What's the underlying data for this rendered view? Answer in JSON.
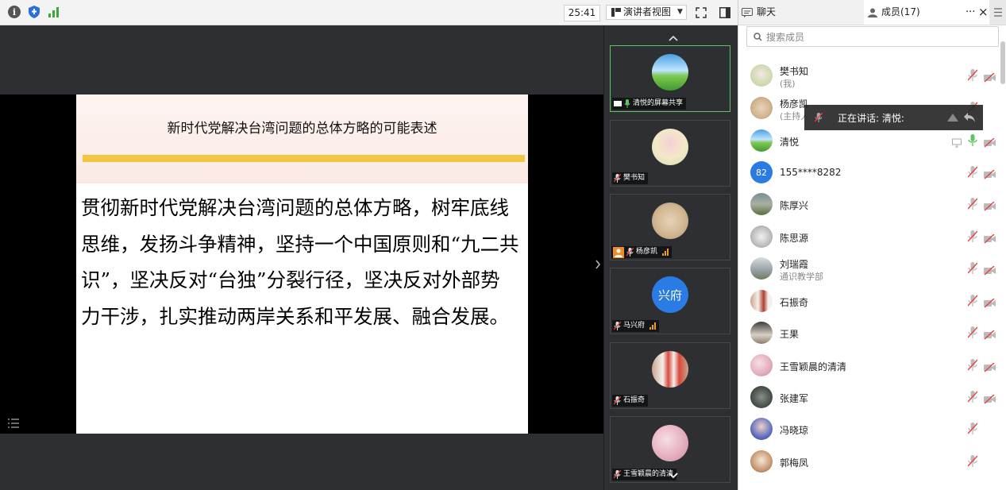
{
  "toolbar": {
    "info_icon_label": "i",
    "timer": "25:41",
    "view_label": "演讲者视图"
  },
  "slide": {
    "title": "新时代党解决台湾问题的总体方略的可能表述",
    "body": "贯彻新时代党解决台湾问题的总体方略，树牢底线思维，发扬斗争精神，坚持一个中国原则和“九二共识”，坚决反对“台独”分裂行径，坚决反对外部势力干涉，扎实推动两岸关系和平发展、融合发展。"
  },
  "thumbnails": [
    {
      "label": "清悦的屏幕共享",
      "active": true
    },
    {
      "label": "樊书知"
    },
    {
      "label": "杨彦凯",
      "signal": true
    },
    {
      "label": "马兴府",
      "signal": true,
      "avatar_text": "兴府"
    },
    {
      "label": "石振奇"
    },
    {
      "label": "王雪颖晨的清清"
    }
  ],
  "panel": {
    "tab_chat": "聊天",
    "tab_members": "成员(17)",
    "more": "···",
    "close": "×",
    "search_placeholder": "搜索成员",
    "tooltip": "正在讲话: 清悦:",
    "members": [
      {
        "name": "樊书知",
        "sub": "(我)"
      },
      {
        "name": "杨彦凯",
        "sub": "(主持人"
      },
      {
        "name": "清悦"
      },
      {
        "name": "155****8282",
        "avatar_text": "82"
      },
      {
        "name": "陈厚兴"
      },
      {
        "name": "陈思源"
      },
      {
        "name": "刘瑞霞",
        "sub": "通识教学部"
      },
      {
        "name": "石振奇"
      },
      {
        "name": "王果"
      },
      {
        "name": "王雪颖晨的清清"
      },
      {
        "name": "张建军"
      },
      {
        "name": "冯晓琼"
      },
      {
        "name": "郭梅凤"
      }
    ]
  },
  "colors": {
    "accent_green": "#5fc35f",
    "slide_bar": "#f2c542",
    "avatar_blue": "#2a7be4"
  }
}
